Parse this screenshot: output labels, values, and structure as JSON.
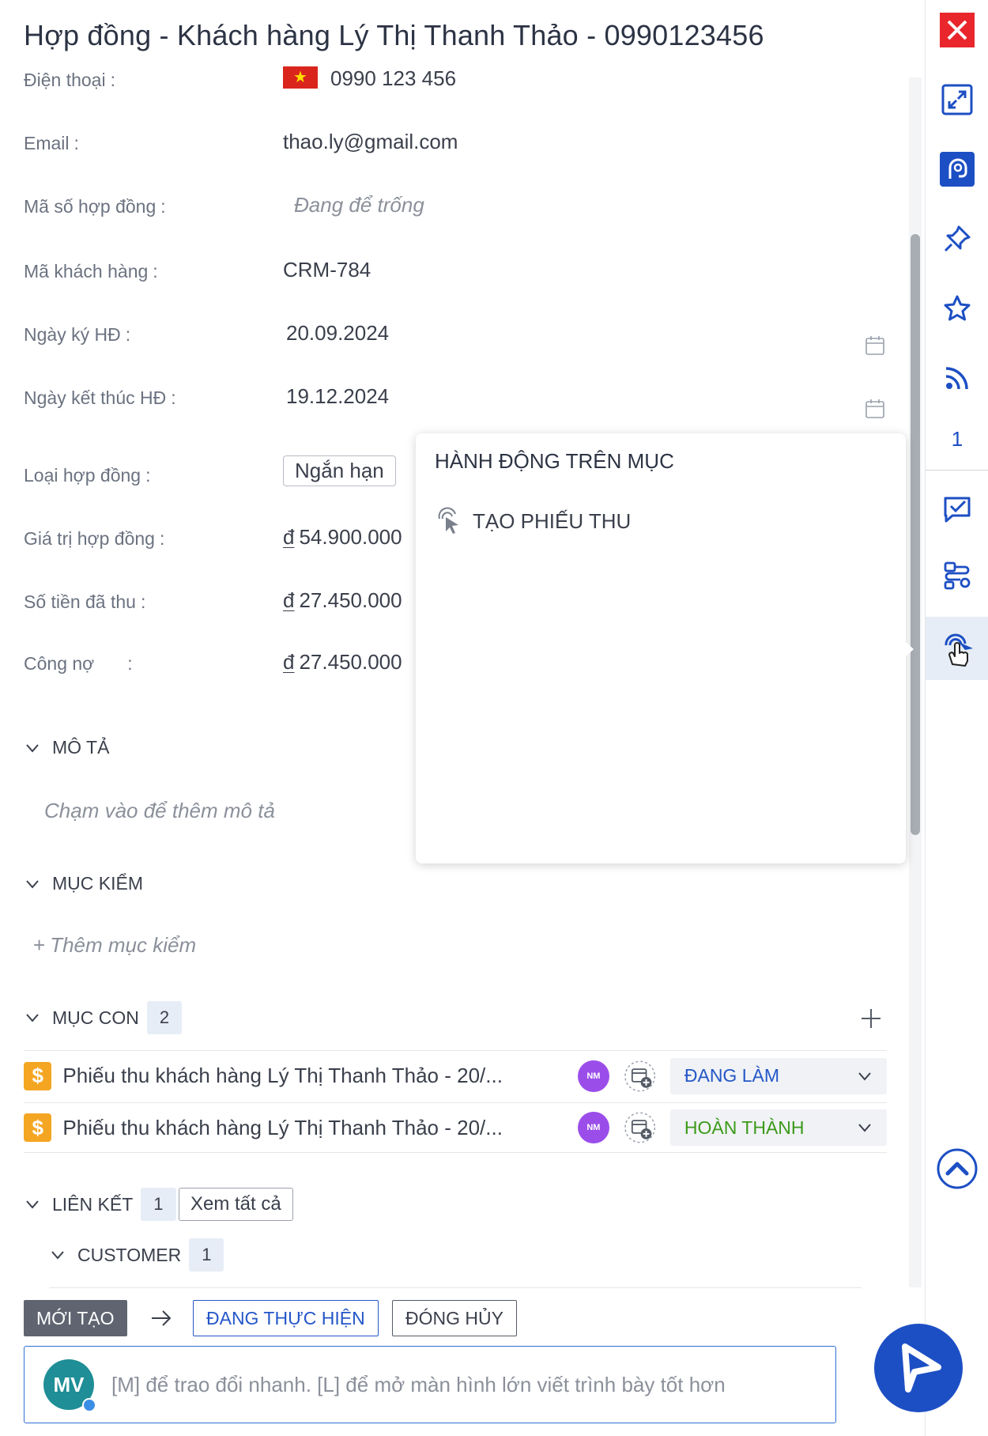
{
  "title": "Hợp đồng - Khách hàng Lý Thị Thanh Thảo - 0990123456",
  "fields": {
    "phone": {
      "label": "Điện thoại",
      "value": "0990 123 456"
    },
    "email": {
      "label": "Email",
      "value": "thao.ly@gmail.com"
    },
    "contract_no": {
      "label": "Mã số hợp đồng",
      "placeholder": "Đang để trống"
    },
    "customer_code": {
      "label": "Mã khách hàng",
      "value": "CRM-784"
    },
    "sign_date": {
      "label": "Ngày ký HĐ",
      "value": "20.09.2024"
    },
    "end_date": {
      "label": "Ngày kết thúc HĐ",
      "value": "19.12.2024"
    },
    "contract_type": {
      "label": "Loại hợp đồng",
      "value": "Ngắn hạn"
    },
    "contract_value": {
      "label": "Giá trị hợp đồng",
      "currency": "đ",
      "value": "54.900.000"
    },
    "paid": {
      "label": "Số tiền đã thu",
      "currency": "đ",
      "value": "27.450.000"
    },
    "debt": {
      "label": "Công nợ",
      "currency": "đ",
      "value": "27.450.000"
    }
  },
  "colon": ":",
  "sections": {
    "description": {
      "label": "MÔ TẢ",
      "hint": "Chạm vào để thêm mô tả"
    },
    "checklist": {
      "label": "MỤC KIỂM",
      "add_label": "Thêm mục kiểm"
    },
    "children": {
      "label": "MỤC CON",
      "count": "2",
      "items": [
        {
          "title": "Phiếu thu khách hàng Lý Thị Thanh Thảo - 20/...",
          "assignee": "NM",
          "status": "ĐANG LÀM",
          "status_color": "#2456c8"
        },
        {
          "title": "Phiếu thu khách hàng Lý Thị Thanh Thảo - 20/...",
          "assignee": "NM",
          "status": "HOÀN THÀNH",
          "status_color": "#3c9a1a"
        }
      ]
    },
    "links": {
      "label": "LIÊN KẾT",
      "count": "1",
      "view_all": "Xem tất cả"
    },
    "customer": {
      "label": "CUSTOMER",
      "count": "1"
    }
  },
  "workflow": {
    "current": "MỚI TẠO",
    "next": [
      "ĐANG THỰC HIỆN",
      "ĐÓNG HỦY"
    ]
  },
  "comment": {
    "avatar": "MV",
    "placeholder": "[M] để trao đổi nhanh. [L] để mở màn hình lớn viết trình bày tốt hơn"
  },
  "popup": {
    "title": "HÀNH ĐỘNG TRÊN MỤC",
    "items": [
      "TẠO PHIẾU THU"
    ]
  },
  "rail": {
    "count": "1",
    "icons": [
      "close-icon",
      "expand-icon",
      "help-icon",
      "pin-icon",
      "star-icon",
      "feed-icon",
      "task-icon",
      "workflow-icon",
      "action-icon",
      "scroll-top-icon"
    ]
  },
  "colors": {
    "accent": "#1d4fc4",
    "close": "#e8262b",
    "avatar": "#1f8e96",
    "assignee": "#9b4dea",
    "money_tag": "#f4a623"
  }
}
